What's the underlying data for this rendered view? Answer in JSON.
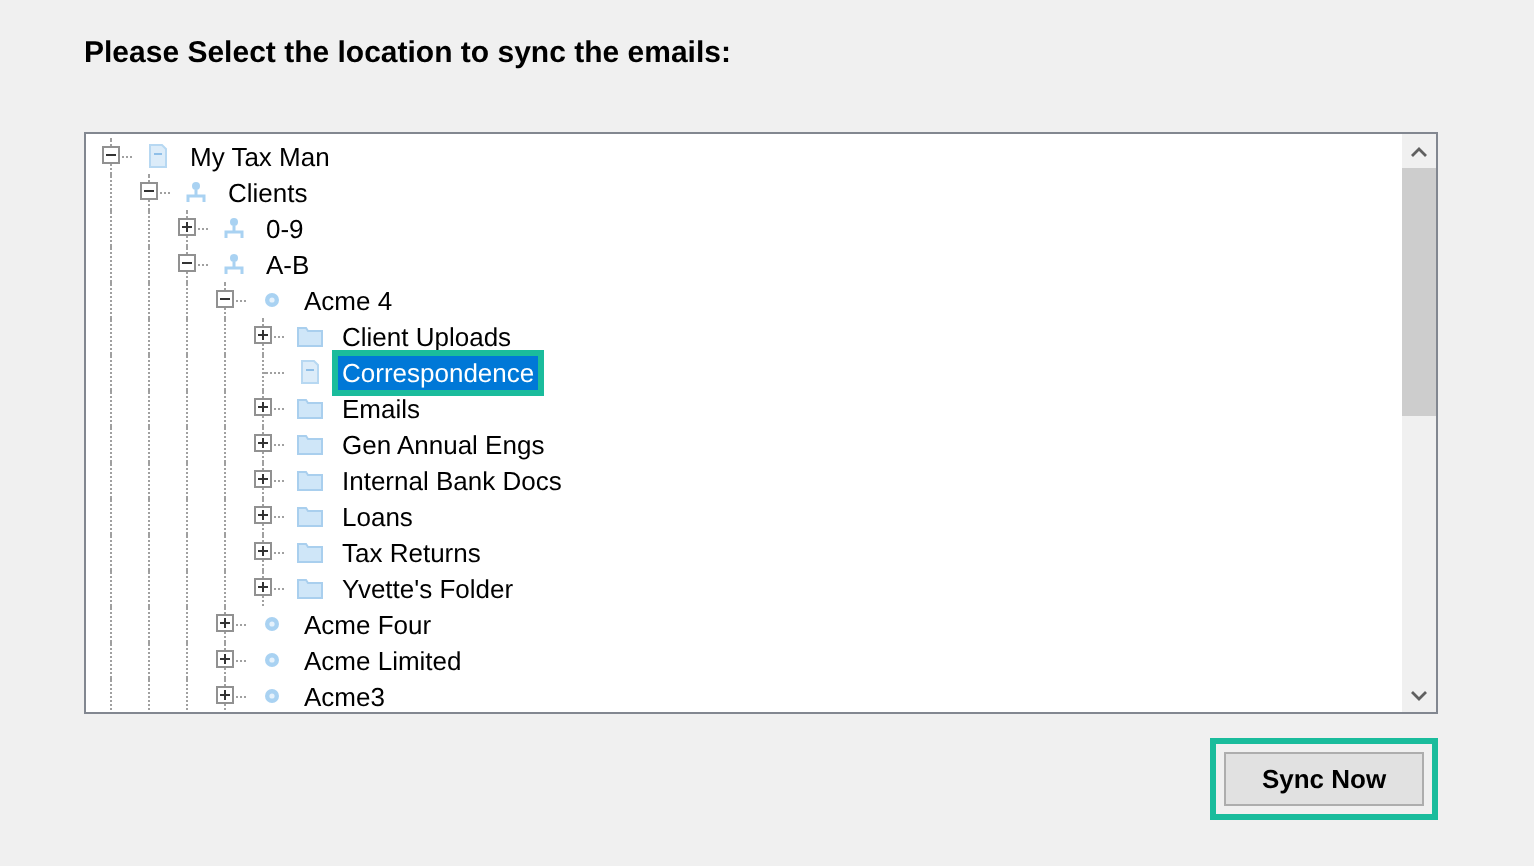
{
  "heading": "Please Select the location to sync the emails:",
  "tree": [
    {
      "label": "My Tax Man",
      "kind": "document",
      "expanded": true,
      "selected": false,
      "children": [
        {
          "label": "Clients",
          "kind": "people",
          "expanded": true,
          "selected": false,
          "children": [
            {
              "label": "0-9",
              "kind": "people",
              "expanded": false,
              "selected": false
            },
            {
              "label": "A-B",
              "kind": "people",
              "expanded": true,
              "selected": false,
              "children": [
                {
                  "label": "Acme 4",
                  "kind": "client",
                  "expanded": true,
                  "selected": false,
                  "children": [
                    {
                      "label": "Client Uploads",
                      "kind": "folder",
                      "expanded": false,
                      "selected": false
                    },
                    {
                      "label": "Correspondence",
                      "kind": "document",
                      "selected": true,
                      "highlighted": true
                    },
                    {
                      "label": "Emails",
                      "kind": "folder",
                      "expanded": false,
                      "selected": false
                    },
                    {
                      "label": "Gen Annual Engs",
                      "kind": "folder",
                      "expanded": false,
                      "selected": false
                    },
                    {
                      "label": "Internal Bank Docs",
                      "kind": "folder",
                      "expanded": false,
                      "selected": false
                    },
                    {
                      "label": "Loans",
                      "kind": "folder",
                      "expanded": false,
                      "selected": false
                    },
                    {
                      "label": "Tax Returns",
                      "kind": "folder",
                      "expanded": false,
                      "selected": false
                    },
                    {
                      "label": "Yvette's Folder",
                      "kind": "folder",
                      "expanded": false,
                      "selected": false
                    }
                  ]
                },
                {
                  "label": "Acme Four",
                  "kind": "client",
                  "expanded": false,
                  "selected": false
                },
                {
                  "label": "Acme Limited",
                  "kind": "client",
                  "expanded": false,
                  "selected": false
                },
                {
                  "label": "Acme3",
                  "kind": "client",
                  "expanded": false,
                  "selected": false
                }
              ]
            }
          ]
        }
      ]
    }
  ],
  "sync_button": {
    "label": "Sync Now",
    "highlighted": true
  }
}
